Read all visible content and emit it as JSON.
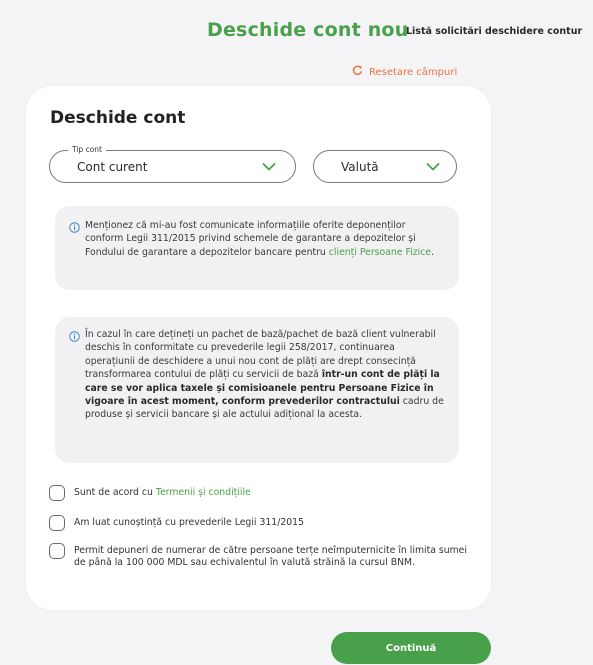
{
  "header": {
    "title": "Deschide cont nou",
    "requests_link": "Listă solicitări deschidere contur"
  },
  "reset": {
    "label": "Resetare câmpuri",
    "icon": "refresh-icon",
    "color": "#e8743b"
  },
  "form": {
    "title": "Deschide cont",
    "account_type": {
      "legend": "Tip cont",
      "value": "Cont curent"
    },
    "currency": {
      "value": "Valută"
    },
    "info1": {
      "text_before": "Menționez că mi-au fost comunicate informațiile oferite deponenților conform Legii 311/2015 privind schemele de garantare a depozitelor și Fondului de garantare a depozitelor bancare pentru ",
      "link": "clienți Persoane Fizice",
      "text_after": "."
    },
    "info2": {
      "text1": "În cazul în care dețineți un pachet de bază/pachet de bază client vulnerabil deschis în conformitate cu prevederile legii 258/2017, continuarea operațiunii de deschidere a unui nou cont de plăți are drept consecință transformarea contului de plăți cu servicii de bază ",
      "bold": "într-un cont de plăți la care se vor aplica taxele și comisioanele pentru Persoane Fizice în vigoare în acest moment, conform prevederilor contractului",
      "text2": " cadru de produse și servicii bancare și ale actului adițional la acesta."
    },
    "checkboxes": [
      {
        "label": "Sunt de acord cu ",
        "link": "Termenii și condițiile",
        "checked": false
      },
      {
        "label": "Am luat cunoștință cu prevederile Legii 311/2015",
        "checked": false
      },
      {
        "label": "Permit depuneri de numerar de către persoane terțe neîmputernicite în limita sumei de până la 100 000 MDL sau echivalentul în valută străină la cursul BNM.",
        "checked": false
      }
    ],
    "continue_label": "Continuă"
  },
  "colors": {
    "brand_green": "#49a04a",
    "background": "#f4f4f6",
    "card": "#ffffff",
    "info_box": "#f1f1f3"
  }
}
